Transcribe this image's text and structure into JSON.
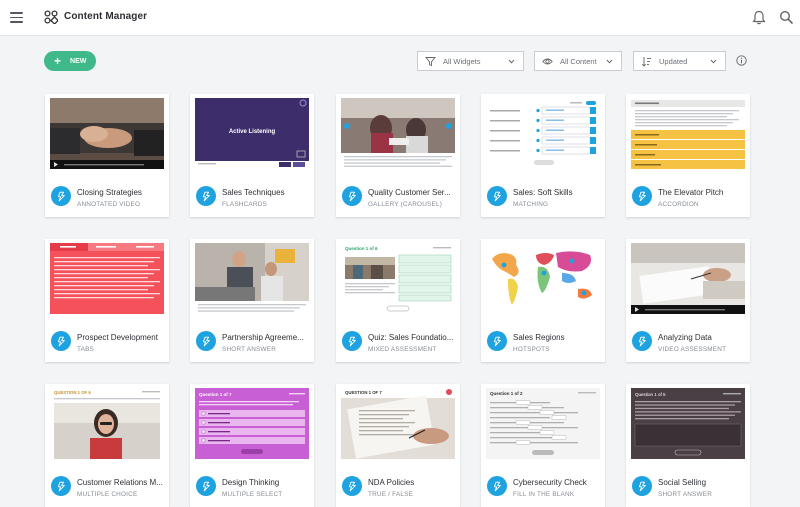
{
  "app": {
    "title": "Content Manager"
  },
  "toolbar": {
    "new_label": "NEW",
    "widgets_filter": "All Widgets",
    "content_filter": "All Content",
    "sort": "Updated"
  },
  "colors": {
    "accent": "#3fb98a",
    "badge": "#1fa3e0"
  },
  "cards": [
    {
      "title": "Closing Strategies",
      "type": "ANNOTATED VIDEO",
      "thumb": "video-handshake"
    },
    {
      "title": "Sales Techniques",
      "type": "FLASHCARDS",
      "thumb": "flashcard",
      "thumb_text": "Active Listening"
    },
    {
      "title": "Quality Customer Ser...",
      "type": "GALLERY (CAROUSEL)",
      "thumb": "gallery"
    },
    {
      "title": "Sales: Soft Skills",
      "type": "MATCHING",
      "thumb": "matching"
    },
    {
      "title": "The Elevator Pitch",
      "type": "ACCORDION",
      "thumb": "accordion"
    },
    {
      "title": "Prospect Development",
      "type": "TABS",
      "thumb": "tabs"
    },
    {
      "title": "Partnership Agreeme...",
      "type": "SHORT ANSWER",
      "thumb": "photo-office"
    },
    {
      "title": "Quiz: Sales Foundatio...",
      "type": "MIXED ASSESSMENT",
      "thumb": "quiz-mixed",
      "thumb_text": "Question 1 of 6"
    },
    {
      "title": "Sales Regions",
      "type": "HOTSPOTS",
      "thumb": "map"
    },
    {
      "title": "Analyzing Data",
      "type": "VIDEO ASSESSMENT",
      "thumb": "video-desk"
    },
    {
      "title": "Customer Relations M...",
      "type": "MULTIPLE CHOICE",
      "thumb": "multi-choice",
      "thumb_text": "QUESTION 1 OF 6"
    },
    {
      "title": "Design Thinking",
      "type": "MULTIPLE SELECT",
      "thumb": "multi-select",
      "thumb_text": "Question 1 of 7"
    },
    {
      "title": "NDA Policies",
      "type": "TRUE / FALSE",
      "thumb": "true-false",
      "thumb_text": "QUESTION 1 OF 7"
    },
    {
      "title": "Cybersecurity Check",
      "type": "FILL IN THE BLANK",
      "thumb": "fill-blank",
      "thumb_text": "Question 1 of 2"
    },
    {
      "title": "Social Selling",
      "type": "SHORT ANSWER",
      "thumb": "short-dark",
      "thumb_text": "Question 1 of 5"
    }
  ]
}
